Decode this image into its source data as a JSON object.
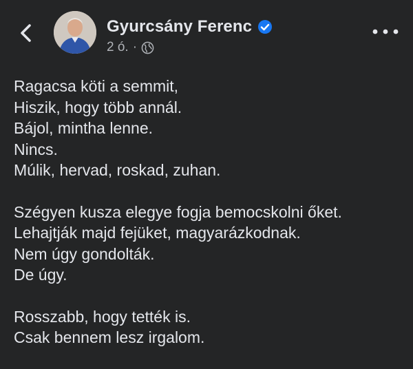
{
  "header": {
    "back_icon": "chevron-left-icon",
    "author_name": "Gyurcsány Ferenc",
    "verified_icon": "verified-badge-icon",
    "time": "2 ó.",
    "separator": "·",
    "audience_icon": "globe-icon",
    "more_icon": "more-horizontal-icon"
  },
  "post": {
    "stanzas": [
      {
        "lines": [
          "Ragacsa köti a semmit,",
          "Hiszik, hogy több annál.",
          "Bájol, mintha lenne.",
          "Nincs.",
          "Múlik, hervad, roskad, zuhan."
        ]
      },
      {
        "lines": [
          "Szégyen kusza elegye fogja bemocskolni őket.",
          "Lehajtják majd fejüket, magyarázkodnak.",
          "Nem úgy gondolták.",
          "De úgy."
        ]
      },
      {
        "lines": [
          "Rosszabb, hogy tették is.",
          "Csak bennem lesz irgalom."
        ]
      }
    ]
  },
  "colors": {
    "background": "#242526",
    "primary_text": "#e4e6eb",
    "secondary_text": "#b0b3b8",
    "verified": "#1877f2"
  }
}
